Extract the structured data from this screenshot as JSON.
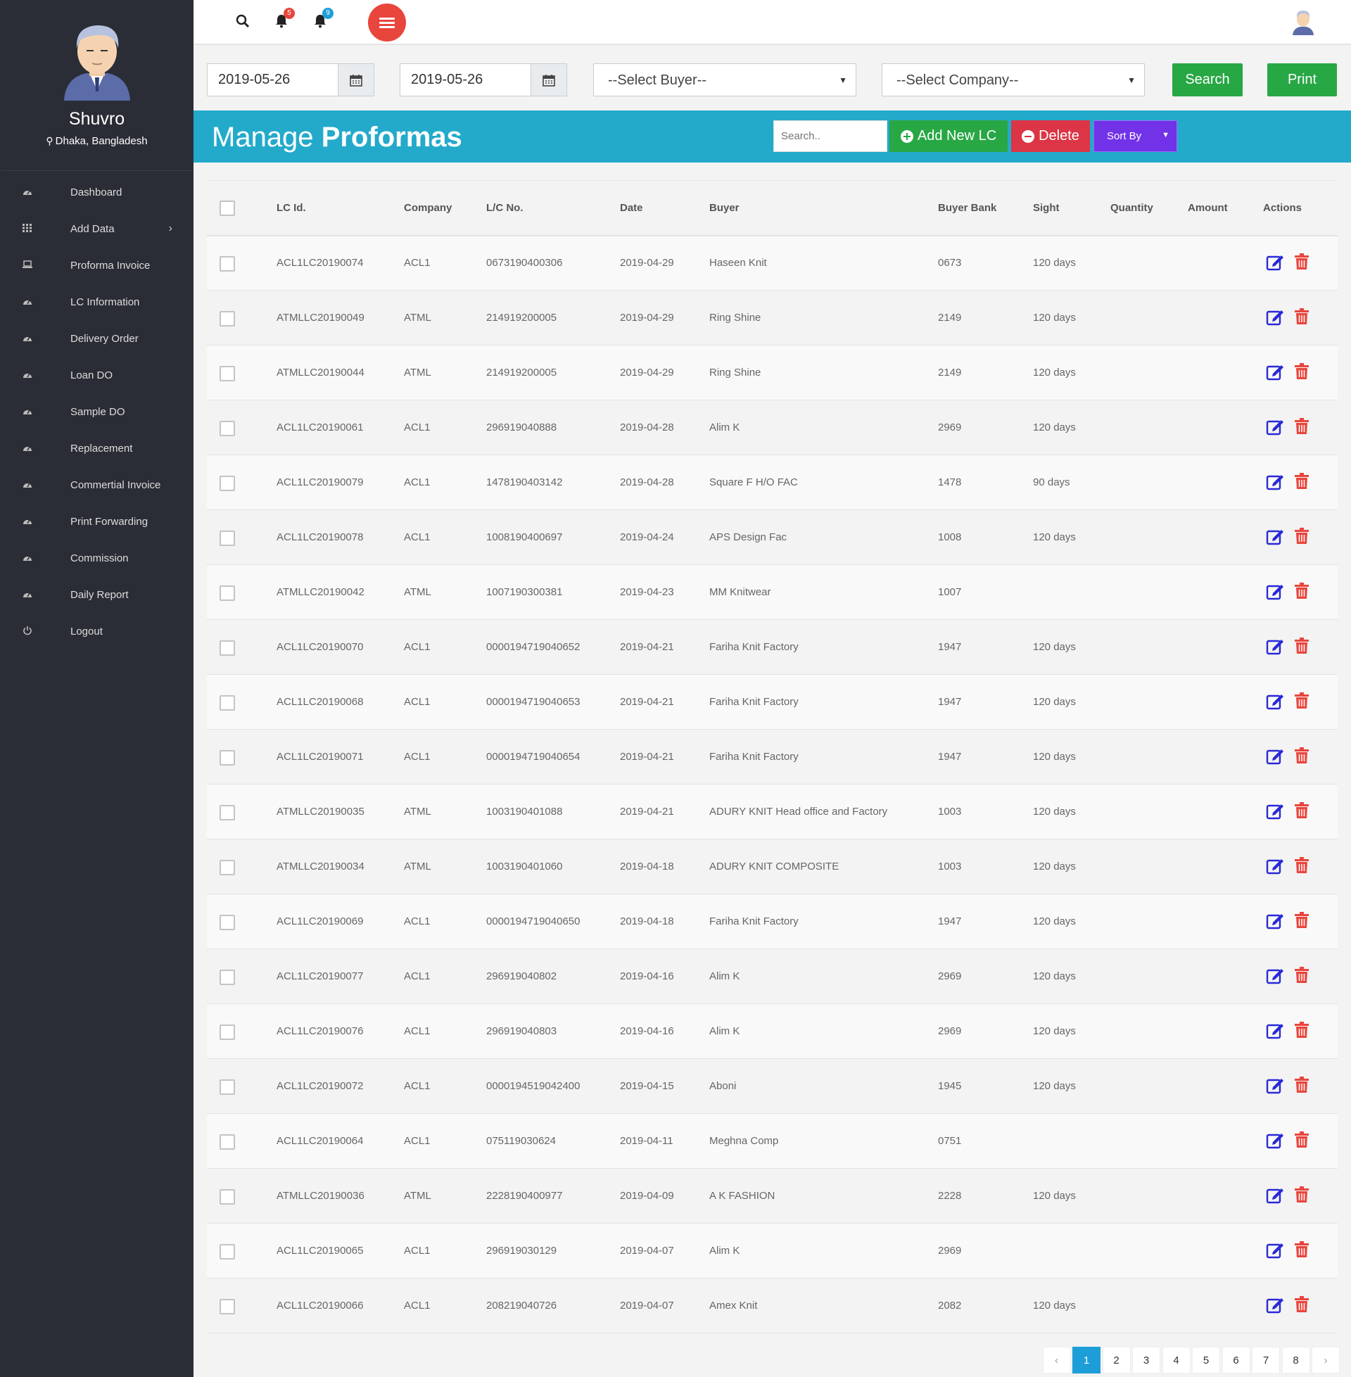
{
  "profile": {
    "name": "Shuvro",
    "location": "Dhaka, Bangladesh"
  },
  "sidebar": {
    "items": [
      {
        "label": "Dashboard",
        "icon": "dashboard-icon"
      },
      {
        "label": "Add Data",
        "icon": "grid-icon",
        "has_submenu": true
      },
      {
        "label": "Proforma Invoice",
        "icon": "laptop-icon"
      },
      {
        "label": "LC Information",
        "icon": "dashboard-icon"
      },
      {
        "label": "Delivery Order",
        "icon": "dashboard-icon"
      },
      {
        "label": "Loan DO",
        "icon": "dashboard-icon"
      },
      {
        "label": "Sample DO",
        "icon": "dashboard-icon"
      },
      {
        "label": "Replacement",
        "icon": "dashboard-icon"
      },
      {
        "label": "Commertial Invoice",
        "icon": "dashboard-icon"
      },
      {
        "label": "Print Forwarding",
        "icon": "dashboard-icon"
      },
      {
        "label": "Commission",
        "icon": "dashboard-icon"
      },
      {
        "label": "Daily Report",
        "icon": "dashboard-icon"
      },
      {
        "label": "Logout",
        "icon": "power-icon"
      }
    ]
  },
  "topbar": {
    "notification_count_1": "5",
    "notification_count_2": "9"
  },
  "filters": {
    "from_date": "2019-05-26",
    "to_date": "2019-05-26",
    "buyer_select": "--Select Buyer--",
    "company_select": "--Select Company--",
    "search_label": "Search",
    "print_label": "Print"
  },
  "header": {
    "title_light": "Manage",
    "title_bold": "Proformas",
    "search_placeholder": "Search..",
    "add_label": "Add New LC",
    "delete_label": "Delete",
    "sort_label": "Sort By"
  },
  "table": {
    "columns": [
      "LC Id.",
      "Company",
      "L/C No.",
      "Date",
      "Buyer",
      "Buyer Bank",
      "Sight",
      "Quantity",
      "Amount",
      "Actions"
    ],
    "rows": [
      [
        "ACL1LC20190074",
        "ACL1",
        "0673190400306",
        "2019-04-29",
        "Haseen Knit",
        "0673",
        "120 days"
      ],
      [
        "ATMLLC20190049",
        "ATML",
        "214919200005",
        "2019-04-29",
        "Ring Shine",
        "2149",
        "120 days"
      ],
      [
        "ATMLLC20190044",
        "ATML",
        "214919200005",
        "2019-04-29",
        "Ring Shine",
        "2149",
        "120 days"
      ],
      [
        "ACL1LC20190061",
        "ACL1",
        "296919040888",
        "2019-04-28",
        "Alim K",
        "2969",
        "120 days"
      ],
      [
        "ACL1LC20190079",
        "ACL1",
        "1478190403142",
        "2019-04-28",
        "Square F H/O FAC",
        "1478",
        "90 days"
      ],
      [
        "ACL1LC20190078",
        "ACL1",
        "1008190400697",
        "2019-04-24",
        "APS Design Fac",
        "1008",
        "120 days"
      ],
      [
        "ATMLLC20190042",
        "ATML",
        "1007190300381",
        "2019-04-23",
        "MM Knitwear",
        "1007",
        ""
      ],
      [
        "ACL1LC20190070",
        "ACL1",
        "0000194719040652",
        "2019-04-21",
        "Fariha Knit Factory",
        "1947",
        "120 days"
      ],
      [
        "ACL1LC20190068",
        "ACL1",
        "0000194719040653",
        "2019-04-21",
        "Fariha Knit Factory",
        "1947",
        "120 days"
      ],
      [
        "ACL1LC20190071",
        "ACL1",
        "0000194719040654",
        "2019-04-21",
        "Fariha Knit Factory",
        "1947",
        "120 days"
      ],
      [
        "ATMLLC20190035",
        "ATML",
        "1003190401088",
        "2019-04-21",
        "ADURY KNIT Head office and Factory",
        "1003",
        "120 days"
      ],
      [
        "ATMLLC20190034",
        "ATML",
        "1003190401060",
        "2019-04-18",
        "ADURY KNIT COMPOSITE",
        "1003",
        "120 days"
      ],
      [
        "ACL1LC20190069",
        "ACL1",
        "0000194719040650",
        "2019-04-18",
        "Fariha Knit Factory",
        "1947",
        "120 days"
      ],
      [
        "ACL1LC20190077",
        "ACL1",
        "296919040802",
        "2019-04-16",
        "Alim K",
        "2969",
        "120 days"
      ],
      [
        "ACL1LC20190076",
        "ACL1",
        "296919040803",
        "2019-04-16",
        "Alim K",
        "2969",
        "120 days"
      ],
      [
        "ACL1LC20190072",
        "ACL1",
        "0000194519042400",
        "2019-04-15",
        "Aboni",
        "1945",
        "120 days"
      ],
      [
        "ACL1LC20190064",
        "ACL1",
        "075119030624",
        "2019-04-11",
        "Meghna Comp",
        "0751",
        ""
      ],
      [
        "ATMLLC20190036",
        "ATML",
        "2228190400977",
        "2019-04-09",
        "A K FASHION",
        "2228",
        "120 days"
      ],
      [
        "ACL1LC20190065",
        "ACL1",
        "296919030129",
        "2019-04-07",
        "Alim K",
        "2969",
        ""
      ],
      [
        "ACL1LC20190066",
        "ACL1",
        "208219040726",
        "2019-04-07",
        "Amex Knit",
        "2082",
        "120 days"
      ]
    ]
  },
  "pagination": {
    "prev": "‹",
    "pages": [
      "1",
      "2",
      "3",
      "4",
      "5",
      "6",
      "7",
      "8"
    ],
    "next": "›",
    "active": "1"
  },
  "colors": {
    "sidebar_bg": "#2a2d35",
    "header_band": "#23aacb",
    "green": "#28a745",
    "red": "#dc3545",
    "purple": "#7232e8",
    "edit_icon": "#2929d8",
    "delete_icon": "#e8453c"
  }
}
